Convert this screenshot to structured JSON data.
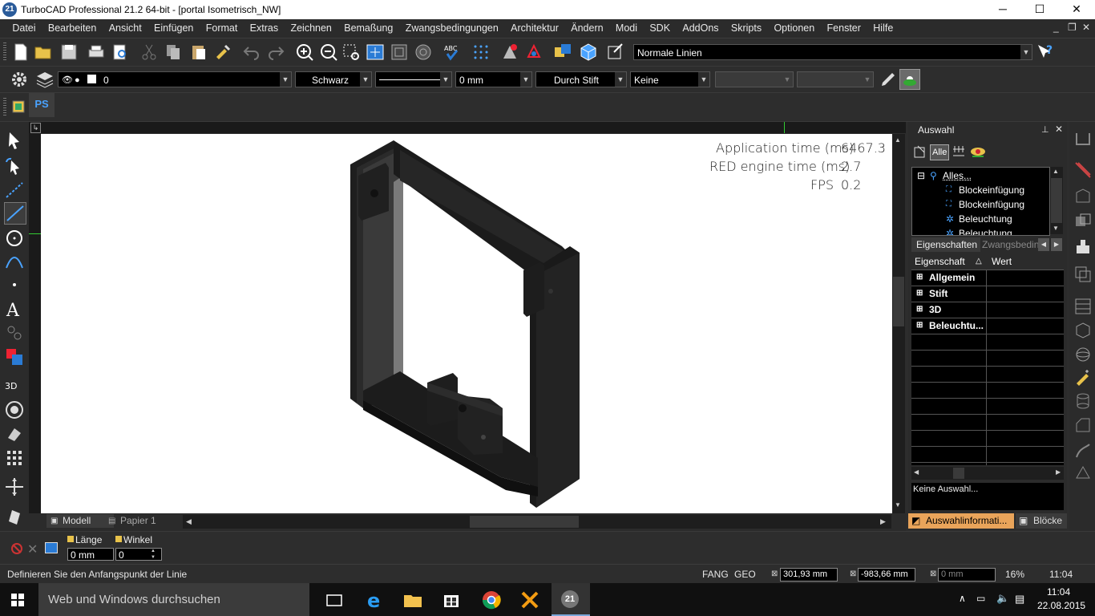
{
  "window": {
    "title": "TurboCAD Professional 21.2 64-bit - [portal Isometrisch_NW]",
    "app_icon_text": "21",
    "minimize_glyph": "─",
    "maximize_glyph": "☐",
    "close_glyph": "✕"
  },
  "menubar": {
    "items": [
      "Datei",
      "Bearbeiten",
      "Ansicht",
      "Einfügen",
      "Format",
      "Extras",
      "Zeichnen",
      "Bemaßung",
      "Zwangsbedingungen",
      "Architektur",
      "Ändern",
      "Modi",
      "SDK",
      "AddOns",
      "Skripts",
      "Optionen",
      "Fenster",
      "Hilfe"
    ],
    "mdi_minimize": "_",
    "mdi_restore": "❐",
    "mdi_close": "✕"
  },
  "toolbar1": {
    "line_style_combo": "Normale Linien"
  },
  "toolbar2": {
    "layer_value": "0",
    "color_value": "Schwarz",
    "width_value": "0 mm",
    "pen_value": "Durch Stift",
    "fill_value": "Keine"
  },
  "toolbar3": {
    "ps_label": "PS"
  },
  "canvas": {
    "stats": [
      {
        "label": "Application time (ms)",
        "value": "6467.3"
      },
      {
        "label": "RED engine time (ms)",
        "value": "2.7"
      },
      {
        "label": "FPS",
        "value": "0.2"
      }
    ]
  },
  "tabs": {
    "model": "Modell",
    "paper": "Papier 1"
  },
  "right_panel": {
    "title": "Auswahl",
    "pin_glyph": "⊥",
    "close_glyph": "✕",
    "filter_all": "Alle",
    "tree": [
      {
        "label": "Alles...",
        "level": 0
      },
      {
        "label": "Blockeinfügung",
        "level": 1
      },
      {
        "label": "Blockeinfügung",
        "level": 1
      },
      {
        "label": "Beleuchtung",
        "level": 1
      },
      {
        "label": "Beleuchtung",
        "level": 1
      }
    ],
    "prop_tabs": [
      "Eigenschaften",
      "Zwangsbeding"
    ],
    "col_property": "Eigenschaft",
    "col_value": "Wert",
    "categories": [
      "Allgemein",
      "Stift",
      "3D",
      "Beleuchtu..."
    ],
    "info_text": "Keine Auswahl...",
    "bottom_tabs": [
      "Auswahlinformati...",
      "Blöcke"
    ]
  },
  "inputbar": {
    "length_label": "Länge",
    "angle_label": "Winkel",
    "length_value": "0 mm",
    "angle_value": "0"
  },
  "statusbar": {
    "prompt": "Definieren Sie den Anfangspunkt der Linie",
    "fang": "FANG",
    "geo": "GEO",
    "x_value": "301,93 mm",
    "y_value": "-983,66 mm",
    "z_value": "0 mm",
    "zoom": "16%",
    "time": "11:04"
  },
  "taskbar": {
    "search_placeholder": "Web und Windows durchsuchen",
    "clock_time": "11:04",
    "clock_date": "22.08.2015"
  },
  "colors": {
    "accent_blue": "#2a7bd5",
    "ps_blue": "#4aa3ff",
    "model_dark": "#1c1c1c"
  }
}
